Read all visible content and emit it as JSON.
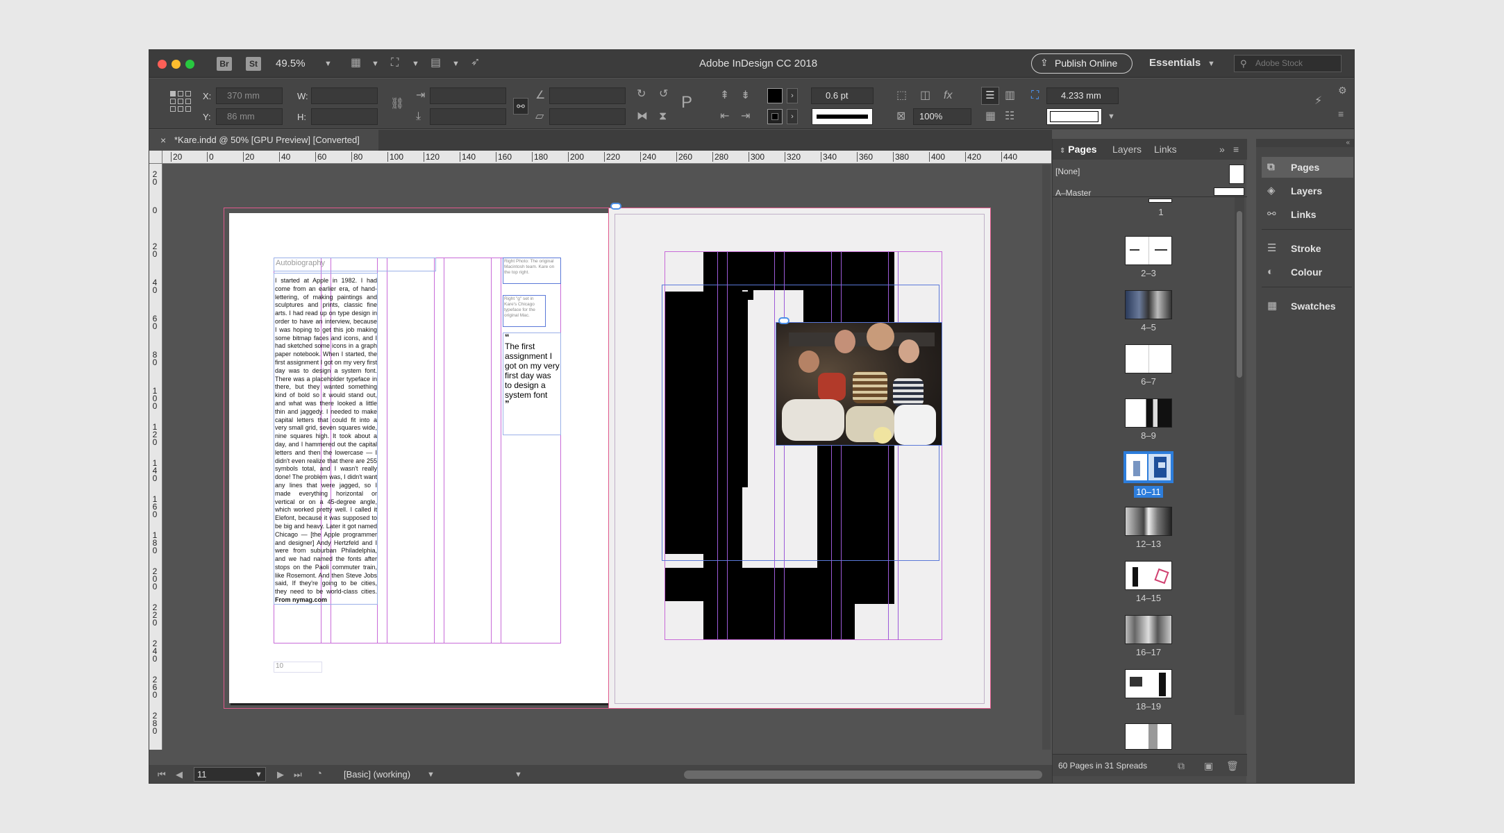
{
  "titlebar": {
    "bridge_badge": "Br",
    "stock_badge": "St",
    "zoom": "49.5%",
    "app_title": "Adobe InDesign CC 2018",
    "publish_label": "Publish Online",
    "workspace": "Essentials",
    "stock_placeholder": "Adobe Stock"
  },
  "control": {
    "x_label": "X:",
    "x_value": "370 mm",
    "y_label": "Y:",
    "y_value": "86 mm",
    "w_label": "W:",
    "h_label": "H:",
    "stroke_weight": "0.6 pt",
    "opacity": "100%",
    "size_value": "4.233 mm"
  },
  "doc_tab": {
    "close": "×",
    "title": "*Kare.indd @ 50% [GPU Preview] [Converted]"
  },
  "ruler": {
    "h_ticks": [
      "20",
      "0",
      "20",
      "40",
      "60",
      "80",
      "100",
      "120",
      "140",
      "160",
      "180",
      "200",
      "220",
      "240",
      "260",
      "280",
      "300",
      "320",
      "340",
      "360",
      "380",
      "400",
      "420",
      "440"
    ],
    "v_ticks": [
      "20",
      "0",
      "20",
      "40",
      "60",
      "80",
      "100",
      "120",
      "140",
      "160",
      "180",
      "200",
      "220",
      "240",
      "260",
      "280"
    ]
  },
  "spread": {
    "left_heading": "Autobiography",
    "body": "I started at Apple in 1982. I had come from an earlier era, of hand-lettering, of making paintings and sculptures and prints, classic fine arts. I had read up on type design in order to have an interview, because I was hoping to get this job making some bitmap faces and icons, and I had sketched some icons in a graph paper notebook. When I started, the first assignment I got on my very first day was to design a system font. There was a placeholder typeface in there, but they wanted something kind of bold so it would stand out, and what was there looked a little thin and jaggedy. I needed to make capital letters that could fit into a very small grid, seven squares wide, nine squares high. It took about a day, and I hammered out the capital letters and then the lowercase — I didn't even realize that there are 255 symbols total, and I wasn't really done! The problem was, I didn't want any lines that were jagged, so I made everything horizontal or vertical or on a 45-degree angle, which worked pretty well. I called it Elefont, because it was supposed to be big and heavy. Later it got named Chicago — [the Apple programmer and designer] Andy Hertzfeld and I were from suburban Philadelphia, and we had named the fonts after stops on the Paoli commuter train, like Rosemont. And then Steve Jobs said, If they're going to be cities, they need to be world-class cities.",
    "source": "From nymag.com",
    "caption1": "Right Photo: The original Macintosh team. Kare on the top right.",
    "caption2": "Right \"g\" set in Kare's Chicago typeface for the original Mac.",
    "open_quote": "“",
    "pull_quote": "The first assignment I got on my very first day was to design a system font",
    "close_quote": "”",
    "folio": "10"
  },
  "status": {
    "page_field": "11",
    "preflight": "[Basic] (working)"
  },
  "pages_panel": {
    "tabs": [
      "Pages",
      "Layers",
      "Links"
    ],
    "none_label": "[None]",
    "master_label": "A–Master",
    "thumbs": [
      "1",
      "2–3",
      "4–5",
      "6–7",
      "8–9",
      "10–11",
      "12–13",
      "14–15",
      "16–17",
      "18–19"
    ],
    "selected": "10–11",
    "footer": "60 Pages in 31 Spreads"
  },
  "dock": {
    "items": [
      "Pages",
      "Layers",
      "Links",
      "Stroke",
      "Colour",
      "Swatches"
    ]
  },
  "colors": {
    "chrome": "#535353",
    "panel": "#4b4b4b",
    "selection": "#2d7ddb",
    "guide_magenta": "#c86ad8",
    "guide_violet": "#9c5ad8"
  }
}
